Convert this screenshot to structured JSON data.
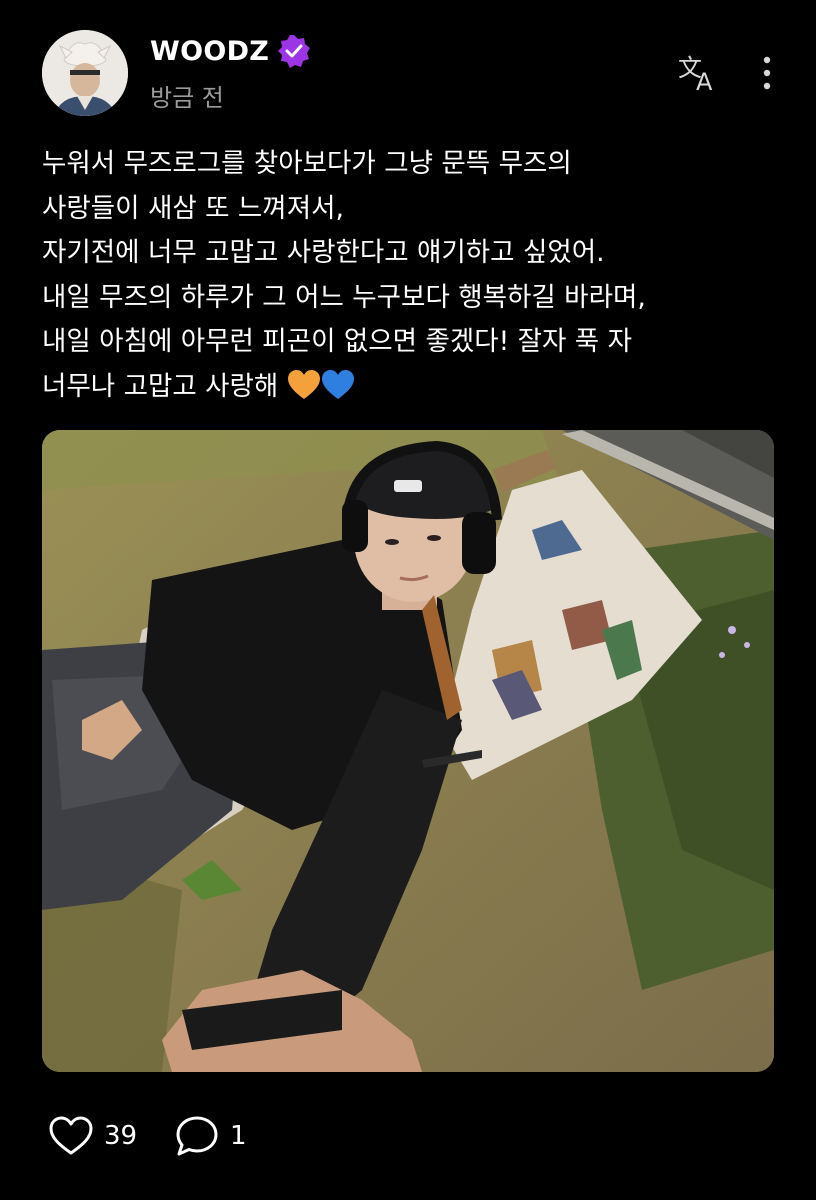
{
  "post": {
    "author": {
      "name": "WOODZ",
      "verified": true,
      "verified_color": "#9b35e6",
      "avatar": "profile-avatar"
    },
    "timestamp": "방금 전",
    "header_icons": [
      "translate-icon",
      "more-vertical-icon"
    ],
    "body_lines": [
      "누워서 무즈로그를 찾아보다가 그냥 문뜩 무즈의",
      "사랑들이 새삼 또 느껴져서,",
      "자기전에 너무 고맙고 사랑한다고 얘기하고 싶었어.",
      "내일 무즈의 하루가 그 어느 누구보다 행복하길 바라며,",
      "내일 아침에 아무런 피곤이 없으면 좋겠다! 잘자 푹 자",
      "너무나 고맙고 사랑해"
    ],
    "emojis": [
      "orange-heart",
      "blue-heart"
    ],
    "photo": "selfie-in-lawn-chair",
    "actions": {
      "likes": "39",
      "comments": "1"
    }
  }
}
